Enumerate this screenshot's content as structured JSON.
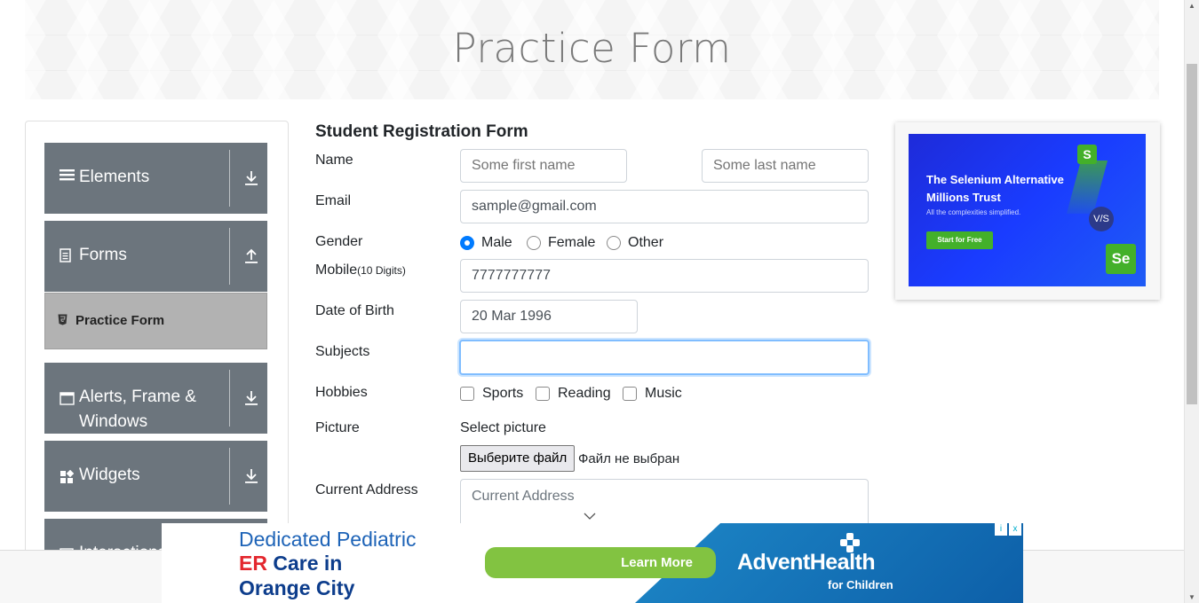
{
  "header": {
    "title": "Practice Form"
  },
  "sidebar": {
    "groups": [
      {
        "label": "Elements",
        "icon": "hamburger-icon",
        "arrow": "download-icon"
      },
      {
        "label": "Forms",
        "icon": "document-icon",
        "arrow": "upload-icon"
      },
      {
        "label": "Alerts, Frame & Windows",
        "icon": "window-icon",
        "arrow": "download-icon"
      },
      {
        "label": "Widgets",
        "icon": "widgets-icon",
        "arrow": "download-icon"
      },
      {
        "label": "Interactions",
        "icon": "cursor-icon",
        "arrow": "download-icon"
      }
    ],
    "active_item": {
      "label": "Practice Form",
      "icon": "html5-icon"
    }
  },
  "form": {
    "title": "Student Registration Form",
    "labels": {
      "name": "Name",
      "email": "Email",
      "gender": "Gender",
      "mobile": "Mobile",
      "mobile_hint": "(10 Digits)",
      "dob": "Date of Birth",
      "subjects": "Subjects",
      "hobbies": "Hobbies",
      "picture": "Picture",
      "address": "Current Address"
    },
    "first_name": {
      "placeholder": "Some first name",
      "value": ""
    },
    "last_name": {
      "placeholder": "Some last name",
      "value": ""
    },
    "email": {
      "value": "sample@gmail.com"
    },
    "gender_options": [
      {
        "label": "Male",
        "selected": true
      },
      {
        "label": "Female",
        "selected": false
      },
      {
        "label": "Other",
        "selected": false
      }
    ],
    "mobile": {
      "value": "7777777777"
    },
    "dob": {
      "value": "20 Mar 1996"
    },
    "subjects": {
      "value": ""
    },
    "hobbies": [
      {
        "label": "Sports",
        "checked": false
      },
      {
        "label": "Reading",
        "checked": false
      },
      {
        "label": "Music",
        "checked": false
      }
    ],
    "picture": {
      "prompt": "Select picture",
      "button": "Выберите файл",
      "status": "Файл не выбран"
    },
    "address": {
      "placeholder": "Current Address"
    }
  },
  "side_ad": {
    "headline_1": "The Selenium Alternative",
    "headline_2": "Millions Trust",
    "subtext": "All the complexities simplified.",
    "button": "Start for Free",
    "badge_s": "S",
    "badge_vs": "V/S",
    "badge_se": "Se"
  },
  "bottom_ad": {
    "line_1": "Dedicated Pediatric",
    "line_2_er": "ER",
    "line_2_rest": " Care in",
    "line_3": "Orange City",
    "button": "Learn More",
    "brand": "AdventHealth",
    "brand_sub": "for Children",
    "info": "i",
    "close": "x"
  },
  "colors": {
    "sidebar_group": "#6c757d",
    "active_item": "#b2b2b2",
    "radio_selected": "#007bff",
    "focus_border": "#80bdff",
    "ad_green": "#43b02a",
    "ad_blue": "#1a3cff"
  }
}
